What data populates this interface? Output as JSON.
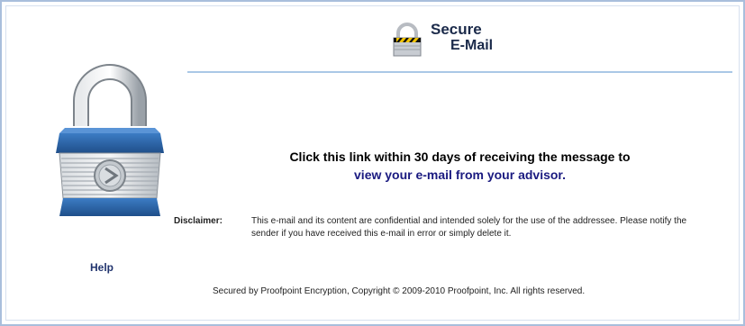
{
  "header": {
    "logo_line1": "Secure",
    "logo_line2": "E-Mail"
  },
  "sidebar": {
    "help_label": "Help"
  },
  "message": {
    "line1": "Click this link within 30 days of receiving the message to",
    "link_text": "view your e-mail from your advisor",
    "period": "."
  },
  "disclaimer": {
    "label": "Disclaimer:",
    "text": "This e-mail and its content are confidential and intended solely for the use of the addressee. Please notify the sender if you have received this e-mail in error or simply delete it."
  },
  "footer": {
    "text": "Secured by Proofpoint Encryption, Copyright © 2009-2010 Proofpoint, Inc. All rights reserved."
  },
  "icons": {
    "header": "small-padlock-icon",
    "main": "padlock-icon"
  },
  "colors": {
    "frame_border": "#a9bedc",
    "divider": "#aac8e6",
    "link": "#1a1a80",
    "padlock_blue": "#2f6bb0"
  }
}
